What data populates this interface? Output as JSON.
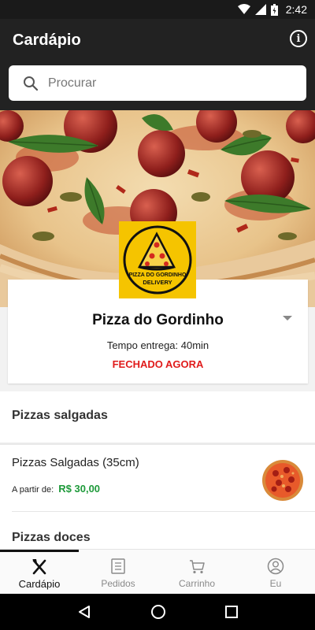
{
  "status_bar": {
    "time": "2:42"
  },
  "app_bar": {
    "title": "Cardápio",
    "info_icon": "info-icon"
  },
  "search": {
    "placeholder": "Procurar"
  },
  "restaurant": {
    "logo_text_top": "PIZZA DO GORDINHO",
    "logo_text_bottom": "DELIVERY",
    "name": "Pizza do Gordinho",
    "delivery_time": "Tempo entrega: 40min",
    "status": "FECHADO AGORA"
  },
  "menu": {
    "categories": [
      {
        "title": "Pizzas salgadas",
        "items": [
          {
            "name": "Pizzas Salgadas (35cm)",
            "price_prefix": "A partir de:",
            "price": "R$ 30,00"
          }
        ]
      },
      {
        "title": "Pizzas doces",
        "items": []
      }
    ]
  },
  "bottom_nav": {
    "items": [
      {
        "label": "Cardápio",
        "icon": "fork-knife-icon",
        "active": true
      },
      {
        "label": "Pedidos",
        "icon": "receipt-icon",
        "active": false
      },
      {
        "label": "Carrinho",
        "icon": "cart-icon",
        "active": false
      },
      {
        "label": "Eu",
        "icon": "user-icon",
        "active": false
      }
    ]
  },
  "colors": {
    "app_bar": "#222222",
    "closed": "#e01b1b",
    "price": "#1e9a3a",
    "logo_bg": "#f5c400"
  }
}
